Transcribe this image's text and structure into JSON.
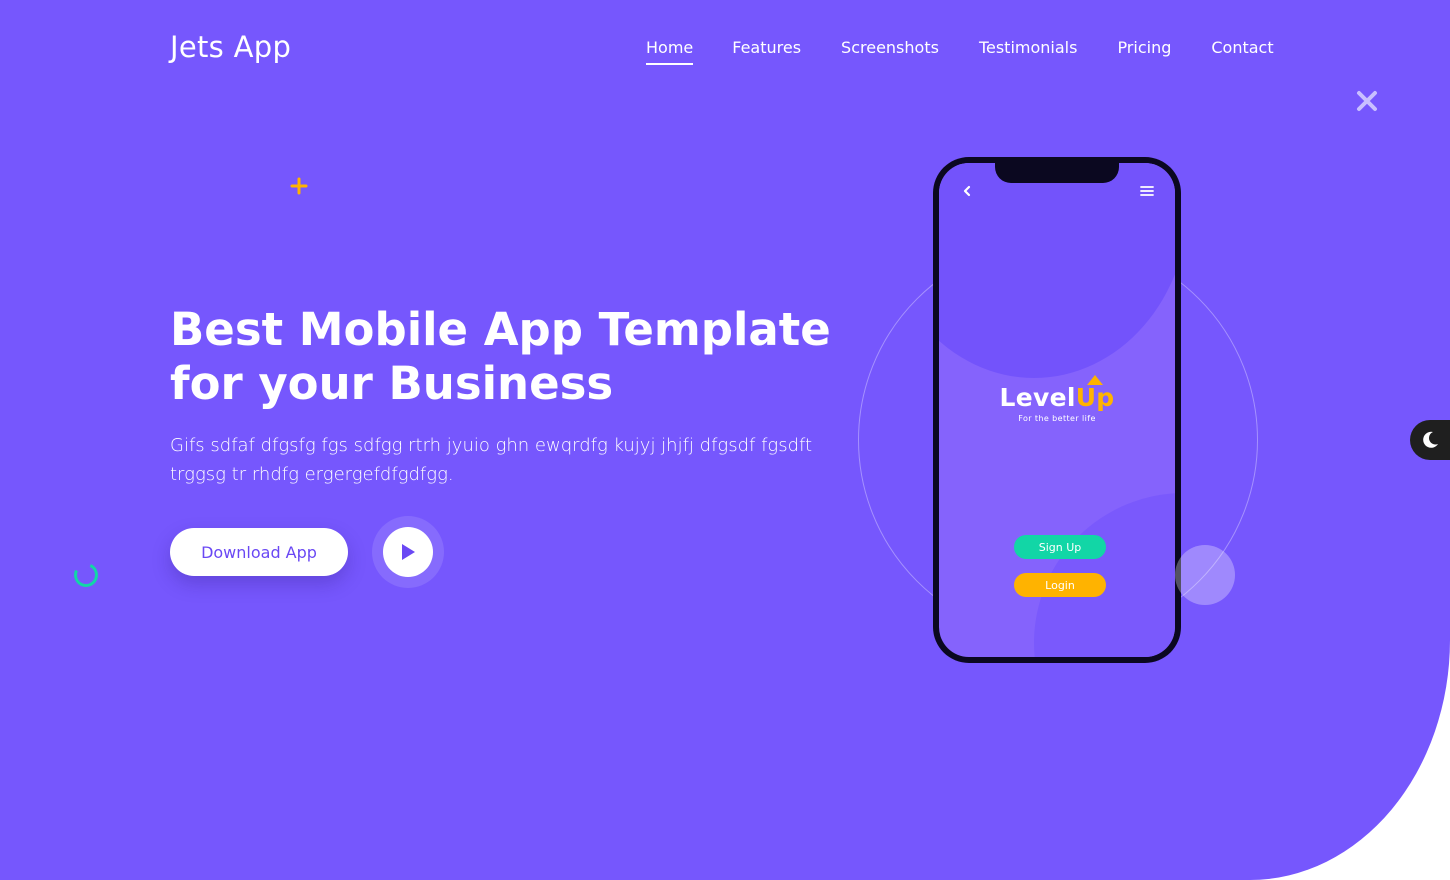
{
  "brand": {
    "name": "Jets App"
  },
  "nav": {
    "items": [
      {
        "label": "Home",
        "active": true
      },
      {
        "label": "Features",
        "active": false
      },
      {
        "label": "Screenshots",
        "active": false
      },
      {
        "label": "Testimonials",
        "active": false
      },
      {
        "label": "Pricing",
        "active": false
      },
      {
        "label": "Contact",
        "active": false
      }
    ]
  },
  "hero": {
    "title": "Best Mobile App Template for your Business",
    "description": "Gifs sdfaf dfgsfg fgs sdfgg rtrh jyuio ghn ewqrdfg kujyj jhjfj dfgsdf fgsdft trggsg tr rhdfg ergergefdfgdfgg.",
    "download_label": "Download App",
    "play_icon": "play-icon"
  },
  "phone": {
    "logo_level": "Level",
    "logo_up": "Up",
    "tagline": "For the better life",
    "signup_label": "Sign Up",
    "login_label": "Login",
    "back_icon": "chevron-left-icon",
    "menu_icon": "hamburger-menu-icon"
  },
  "decor": {
    "close_icon": "close-icon",
    "plus_icon": "plus-icon",
    "theme_icon": "moon-icon"
  },
  "colors": {
    "primary": "#7657fd",
    "accent_green": "#12d6a6",
    "accent_yellow": "#ffb300",
    "white": "#ffffff",
    "dark": "#1f1f1f"
  }
}
